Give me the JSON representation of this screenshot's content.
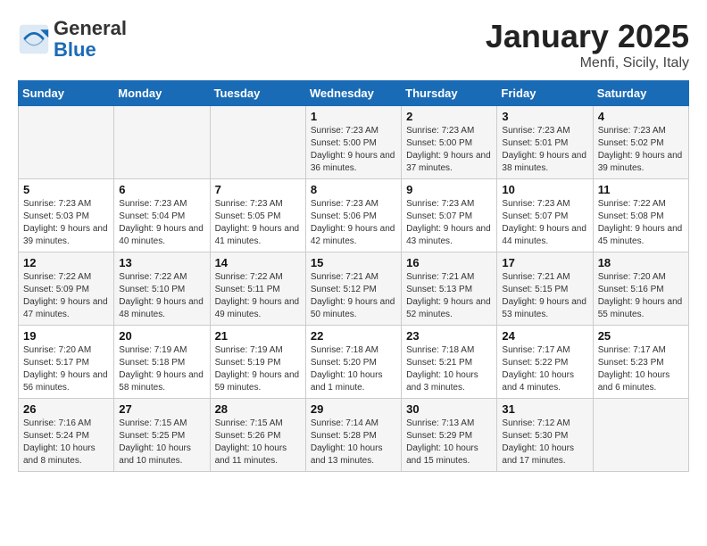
{
  "logo": {
    "general": "General",
    "blue": "Blue"
  },
  "title": "January 2025",
  "location": "Menfi, Sicily, Italy",
  "days_of_week": [
    "Sunday",
    "Monday",
    "Tuesday",
    "Wednesday",
    "Thursday",
    "Friday",
    "Saturday"
  ],
  "weeks": [
    [
      {
        "day": "",
        "content": ""
      },
      {
        "day": "",
        "content": ""
      },
      {
        "day": "",
        "content": ""
      },
      {
        "day": "1",
        "content": "Sunrise: 7:23 AM\nSunset: 5:00 PM\nDaylight: 9 hours and 36 minutes."
      },
      {
        "day": "2",
        "content": "Sunrise: 7:23 AM\nSunset: 5:00 PM\nDaylight: 9 hours and 37 minutes."
      },
      {
        "day": "3",
        "content": "Sunrise: 7:23 AM\nSunset: 5:01 PM\nDaylight: 9 hours and 38 minutes."
      },
      {
        "day": "4",
        "content": "Sunrise: 7:23 AM\nSunset: 5:02 PM\nDaylight: 9 hours and 39 minutes."
      }
    ],
    [
      {
        "day": "5",
        "content": "Sunrise: 7:23 AM\nSunset: 5:03 PM\nDaylight: 9 hours and 39 minutes."
      },
      {
        "day": "6",
        "content": "Sunrise: 7:23 AM\nSunset: 5:04 PM\nDaylight: 9 hours and 40 minutes."
      },
      {
        "day": "7",
        "content": "Sunrise: 7:23 AM\nSunset: 5:05 PM\nDaylight: 9 hours and 41 minutes."
      },
      {
        "day": "8",
        "content": "Sunrise: 7:23 AM\nSunset: 5:06 PM\nDaylight: 9 hours and 42 minutes."
      },
      {
        "day": "9",
        "content": "Sunrise: 7:23 AM\nSunset: 5:07 PM\nDaylight: 9 hours and 43 minutes."
      },
      {
        "day": "10",
        "content": "Sunrise: 7:23 AM\nSunset: 5:07 PM\nDaylight: 9 hours and 44 minutes."
      },
      {
        "day": "11",
        "content": "Sunrise: 7:22 AM\nSunset: 5:08 PM\nDaylight: 9 hours and 45 minutes."
      }
    ],
    [
      {
        "day": "12",
        "content": "Sunrise: 7:22 AM\nSunset: 5:09 PM\nDaylight: 9 hours and 47 minutes."
      },
      {
        "day": "13",
        "content": "Sunrise: 7:22 AM\nSunset: 5:10 PM\nDaylight: 9 hours and 48 minutes."
      },
      {
        "day": "14",
        "content": "Sunrise: 7:22 AM\nSunset: 5:11 PM\nDaylight: 9 hours and 49 minutes."
      },
      {
        "day": "15",
        "content": "Sunrise: 7:21 AM\nSunset: 5:12 PM\nDaylight: 9 hours and 50 minutes."
      },
      {
        "day": "16",
        "content": "Sunrise: 7:21 AM\nSunset: 5:13 PM\nDaylight: 9 hours and 52 minutes."
      },
      {
        "day": "17",
        "content": "Sunrise: 7:21 AM\nSunset: 5:15 PM\nDaylight: 9 hours and 53 minutes."
      },
      {
        "day": "18",
        "content": "Sunrise: 7:20 AM\nSunset: 5:16 PM\nDaylight: 9 hours and 55 minutes."
      }
    ],
    [
      {
        "day": "19",
        "content": "Sunrise: 7:20 AM\nSunset: 5:17 PM\nDaylight: 9 hours and 56 minutes."
      },
      {
        "day": "20",
        "content": "Sunrise: 7:19 AM\nSunset: 5:18 PM\nDaylight: 9 hours and 58 minutes."
      },
      {
        "day": "21",
        "content": "Sunrise: 7:19 AM\nSunset: 5:19 PM\nDaylight: 9 hours and 59 minutes."
      },
      {
        "day": "22",
        "content": "Sunrise: 7:18 AM\nSunset: 5:20 PM\nDaylight: 10 hours and 1 minute."
      },
      {
        "day": "23",
        "content": "Sunrise: 7:18 AM\nSunset: 5:21 PM\nDaylight: 10 hours and 3 minutes."
      },
      {
        "day": "24",
        "content": "Sunrise: 7:17 AM\nSunset: 5:22 PM\nDaylight: 10 hours and 4 minutes."
      },
      {
        "day": "25",
        "content": "Sunrise: 7:17 AM\nSunset: 5:23 PM\nDaylight: 10 hours and 6 minutes."
      }
    ],
    [
      {
        "day": "26",
        "content": "Sunrise: 7:16 AM\nSunset: 5:24 PM\nDaylight: 10 hours and 8 minutes."
      },
      {
        "day": "27",
        "content": "Sunrise: 7:15 AM\nSunset: 5:25 PM\nDaylight: 10 hours and 10 minutes."
      },
      {
        "day": "28",
        "content": "Sunrise: 7:15 AM\nSunset: 5:26 PM\nDaylight: 10 hours and 11 minutes."
      },
      {
        "day": "29",
        "content": "Sunrise: 7:14 AM\nSunset: 5:28 PM\nDaylight: 10 hours and 13 minutes."
      },
      {
        "day": "30",
        "content": "Sunrise: 7:13 AM\nSunset: 5:29 PM\nDaylight: 10 hours and 15 minutes."
      },
      {
        "day": "31",
        "content": "Sunrise: 7:12 AM\nSunset: 5:30 PM\nDaylight: 10 hours and 17 minutes."
      },
      {
        "day": "",
        "content": ""
      }
    ]
  ]
}
